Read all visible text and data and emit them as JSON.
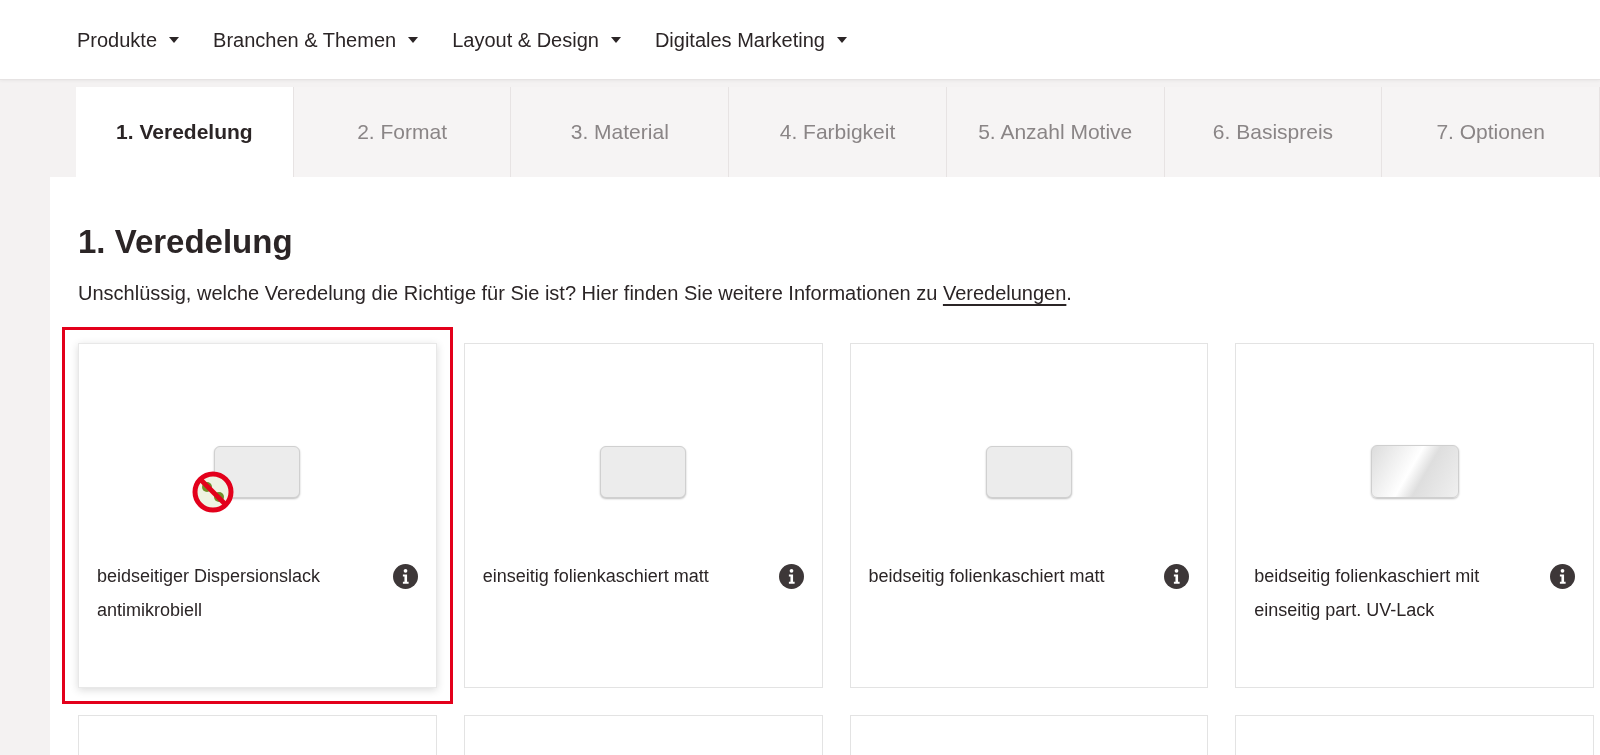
{
  "nav": [
    {
      "label": "Produkte"
    },
    {
      "label": "Branchen & Themen"
    },
    {
      "label": "Layout & Design"
    },
    {
      "label": "Digitales Marketing"
    }
  ],
  "tabs": [
    {
      "label": "1. Veredelung",
      "selected": true
    },
    {
      "label": "2. Format",
      "selected": false
    },
    {
      "label": "3. Material",
      "selected": false
    },
    {
      "label": "4. Farbigkeit",
      "selected": false
    },
    {
      "label": "5. Anzahl Motive",
      "selected": false
    },
    {
      "label": "6. Basispreis",
      "selected": false
    },
    {
      "label": "7. Optionen",
      "selected": false
    }
  ],
  "heading": "1. Veredelung",
  "intro": {
    "text": "Unschlüssig, welche Veredelung die Richtige für Sie ist? Hier finden Sie weitere Informationen zu ",
    "link": "Veredelungen",
    "after": "."
  },
  "cards": [
    {
      "kind": "antimicrobial",
      "label": "beidseitiger Dispersionslack antimikrobiell",
      "selected": true
    },
    {
      "kind": "matt",
      "label": "einseitig folienkaschiert matt",
      "selected": false
    },
    {
      "kind": "matt",
      "label": "beidseitig folienkaschiert matt",
      "selected": false
    },
    {
      "kind": "gloss",
      "label": "beidseitig folienkaschiert mit einseitig part. UV-Lack",
      "selected": false
    },
    {
      "kind": "cutoff"
    },
    {
      "kind": "cutoff"
    },
    {
      "kind": "cutoff"
    },
    {
      "kind": "cutoff"
    }
  ]
}
